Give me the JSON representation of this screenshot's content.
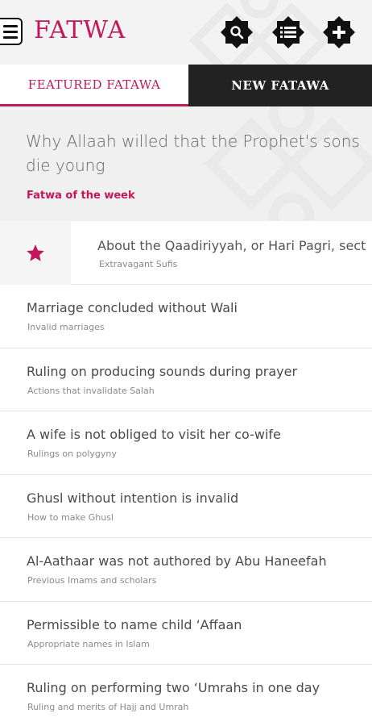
{
  "header": {
    "logo": "FATWA",
    "icons": {
      "menu": "hamburger-menu-icon",
      "search": "search-icon",
      "list": "list-icon",
      "add": "plus-icon"
    }
  },
  "tabs": [
    {
      "label": "FEATURED FATAWA",
      "active": true
    },
    {
      "label": "NEW FATAWA",
      "active": false
    }
  ],
  "fatwa_of_week": {
    "title": "Why Allaah willed that the Prophet's sons die young",
    "label": "Fatwa of the week"
  },
  "featured": {
    "title": "About the Qaadiriyyah, or Hari Pagri, sect",
    "category": "Extravagant Sufis"
  },
  "items": [
    {
      "title": "Marriage concluded without Wali",
      "category": "Invalid marriages"
    },
    {
      "title": "Ruling on producing sounds during prayer",
      "category": "Actions that invalidate Salah"
    },
    {
      "title": "A wife is not obliged to visit her co-wife",
      "category": "Rulings on polygyny"
    },
    {
      "title": "Ghusl without intention is invalid",
      "category": "How to make Ghusl"
    },
    {
      "title": "Al-Aathaar was not authored by Abu Haneefah",
      "category": "Previous Imams and scholars"
    },
    {
      "title": "Permissible to name child ‘Affaan",
      "category": "Appropriate names in Islam"
    },
    {
      "title": "Ruling on performing two ‘Umrahs in one day",
      "category": "Ruling and merits of Hajj and Umrah"
    }
  ],
  "colors": {
    "accent": "#c2185b",
    "dark": "#222222"
  }
}
